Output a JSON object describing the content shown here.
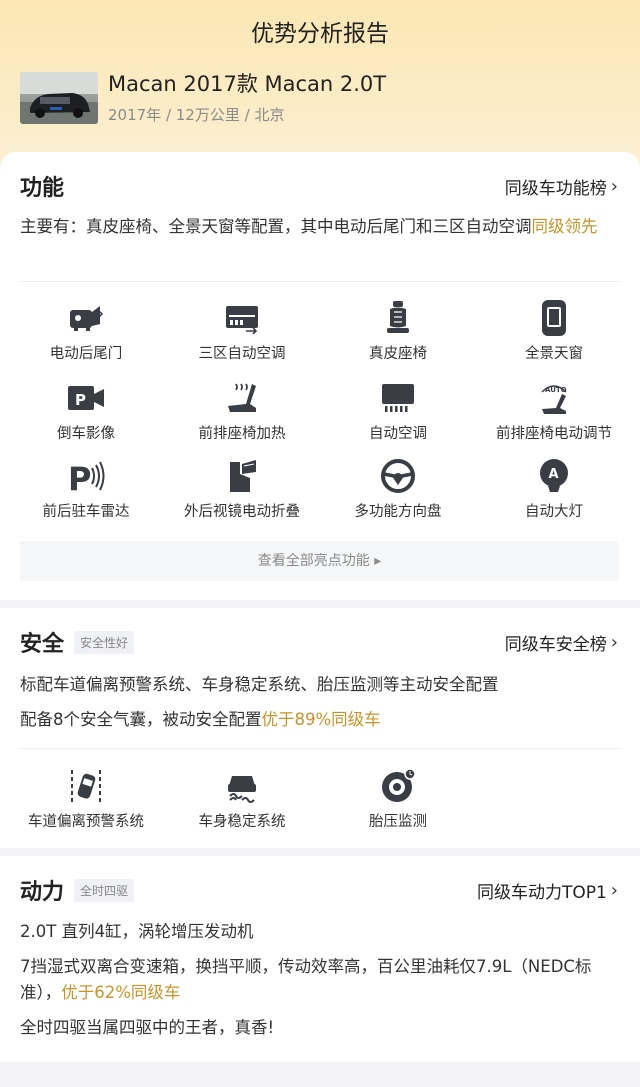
{
  "page_title": "优势分析报告",
  "car": {
    "name": "Macan 2017款 Macan 2.0T",
    "meta": "2017年 / 12万公里 / 北京"
  },
  "function": {
    "title": "功能",
    "link": "同级车功能榜",
    "desc_prefix": "主要有：真皮座椅、全景天窗等配置，其中电动后尾门和三区自动空调",
    "desc_highlight": "同级领先",
    "features": [
      {
        "label": "电动后尾门",
        "icon": "tailgate-icon"
      },
      {
        "label": "三区自动空调",
        "icon": "air-conditioner-icon"
      },
      {
        "label": "真皮座椅",
        "icon": "leather-seat-icon"
      },
      {
        "label": "全景天窗",
        "icon": "sunroof-icon"
      },
      {
        "label": "倒车影像",
        "icon": "reverse-camera-icon"
      },
      {
        "label": "前排座椅加热",
        "icon": "seat-heating-icon"
      },
      {
        "label": "自动空调",
        "icon": "auto-ac-icon"
      },
      {
        "label": "前排座椅电动调节",
        "icon": "seat-adjust-icon"
      },
      {
        "label": "前后驻车雷达",
        "icon": "parking-radar-icon"
      },
      {
        "label": "外后视镜电动折叠",
        "icon": "mirror-fold-icon"
      },
      {
        "label": "多功能方向盘",
        "icon": "steering-wheel-icon"
      },
      {
        "label": "自动大灯",
        "icon": "auto-headlight-icon"
      }
    ],
    "see_all": "查看全部亮点功能 ▸"
  },
  "safety": {
    "title": "安全",
    "tag": "安全性好",
    "link": "同级车安全榜",
    "line1": "标配车道偏离预警系统、车身稳定系统、胎压监测等主动安全配置",
    "line2_prefix": "配备8个安全气囊，被动安全配置",
    "line2_highlight": "优于89%同级车",
    "features": [
      {
        "label": "车道偏离预警系统",
        "icon": "lane-departure-icon"
      },
      {
        "label": "车身稳定系统",
        "icon": "stability-control-icon"
      },
      {
        "label": "胎压监测",
        "icon": "tire-pressure-icon"
      }
    ]
  },
  "power": {
    "title": "动力",
    "tag": "全时四驱",
    "link": "同级车动力TOP1",
    "line1": "2.0T 直列4缸，涡轮增压发动机",
    "line2_prefix": "7挡湿式双离合变速箱，换挡平顺，传动效率高，百公里油耗仅7.9L（NEDC标准），",
    "line2_highlight": "优于62%同级车",
    "line3": "全时四驱当属四驱中的王者，真香!"
  },
  "colors": {
    "accent": "#c9932a",
    "header_bg": "#fbe7b4"
  }
}
